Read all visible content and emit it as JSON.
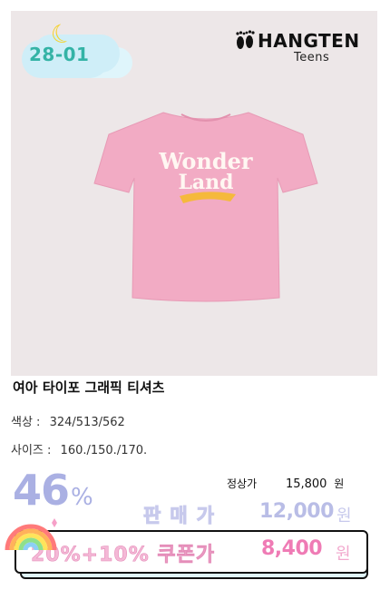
{
  "badge": {
    "code": "28-01"
  },
  "brand": {
    "name": "HANGTEN",
    "sub": "Teens"
  },
  "shirt": {
    "print_line1": "Wonder",
    "print_line2": "Land"
  },
  "product": {
    "title": "여아 타이포 그래픽 티셔츠",
    "color_label": "색상 :",
    "color_value": "324/513/562",
    "size_label": "사이즈 :",
    "size_value": "160./150./170."
  },
  "pricing": {
    "discount_value": "46",
    "discount_unit": "%",
    "regular_label": "정상가",
    "regular_price": "15,800",
    "regular_unit": "원",
    "sale_label": "판매가",
    "sale_price": "12,000",
    "sale_unit": "원"
  },
  "coupon": {
    "label": "20%+10% 쿠폰가",
    "price": "8,400",
    "unit": "원"
  },
  "colors": {
    "photo_bg": "#ede7e8",
    "shirt_pink": "#f2abc4",
    "discount": "#aab0e3",
    "coupon_pink": "#ef7bb5",
    "badge_teal": "#34b3a6"
  }
}
